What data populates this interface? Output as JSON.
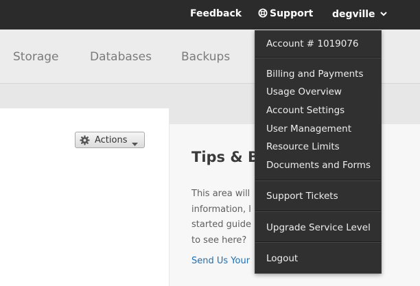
{
  "topbar": {
    "feedback": "Feedback",
    "support": "Support",
    "username": "degville",
    "icons": {
      "support": "lifebuoy-icon",
      "user_menu": "chevron-down-icon"
    }
  },
  "subnav": {
    "items": [
      "Storage",
      "Databases",
      "Backups"
    ]
  },
  "left_panel": {
    "actions_button": "Actions",
    "icons": {
      "actions": "gear-icon",
      "caret": "caret-down-icon"
    }
  },
  "tips": {
    "title": "Tips & Be",
    "lines": [
      "This area will",
      "information, l",
      "started guide",
      "to see here?"
    ],
    "link": "Send Us Your"
  },
  "account_menu": {
    "account": "Account # 1019076",
    "group1": [
      "Billing and Payments",
      "Usage Overview",
      "Account Settings",
      "User Management",
      "Resource Limits",
      "Documents and Forms"
    ],
    "support_tickets": "Support Tickets",
    "upgrade": "Upgrade Service Level",
    "logout": "Logout"
  },
  "colors": {
    "topbar_bg": "#2b2b2b",
    "menu_bg": "#303030",
    "link": "#1c6fb5"
  }
}
